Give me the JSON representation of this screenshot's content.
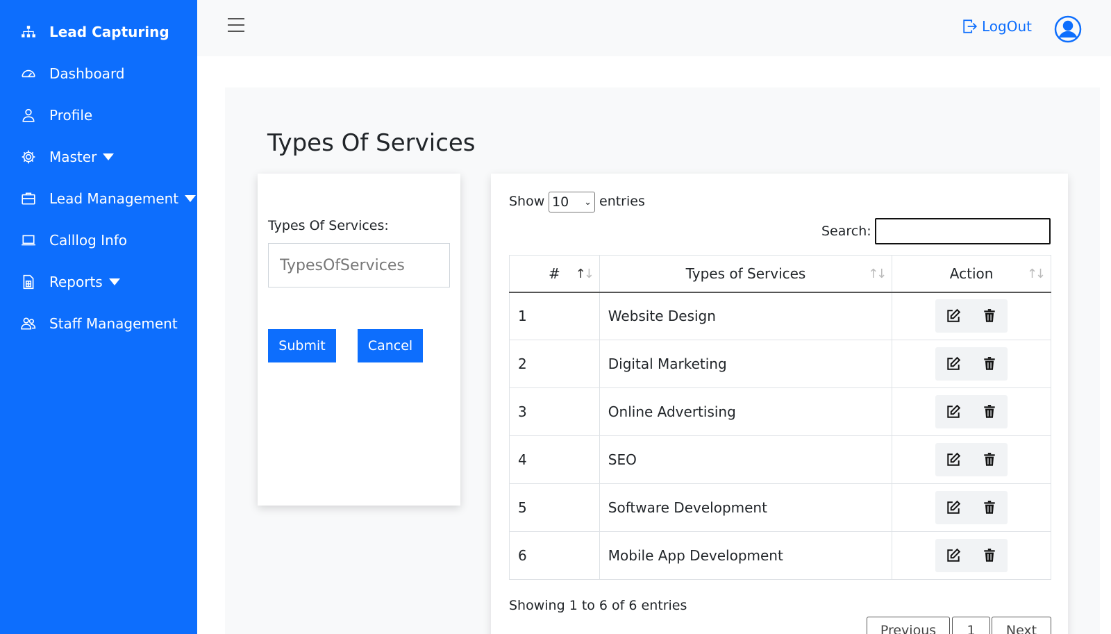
{
  "sidebar": {
    "brand": "Lead Capturing",
    "items": [
      {
        "label": "Dashboard",
        "icon": "speedometer-icon"
      },
      {
        "label": "Profile",
        "icon": "person-icon"
      },
      {
        "label": "Master",
        "icon": "gear-icon",
        "dropdown": true
      },
      {
        "label": "Lead Management",
        "icon": "briefcase-icon",
        "dropdown": true
      },
      {
        "label": "Calllog Info",
        "icon": "laptop-icon"
      },
      {
        "label": "Reports",
        "icon": "report-icon",
        "dropdown": true
      },
      {
        "label": "Staff Management",
        "icon": "people-icon"
      }
    ]
  },
  "header": {
    "logout_label": "LogOut"
  },
  "page": {
    "title": "Types Of Services"
  },
  "form": {
    "label": "Types Of Services:",
    "placeholder": "TypesOfServices",
    "submit_label": "Submit",
    "cancel_label": "Cancel"
  },
  "table": {
    "show_label": "Show",
    "page_size": "10",
    "entries_label": "entries",
    "search_label": "Search:",
    "columns": [
      "#",
      "Types of Services",
      "Action"
    ],
    "rows": [
      {
        "num": "1",
        "service": "Website Design"
      },
      {
        "num": "2",
        "service": "Digital Marketing"
      },
      {
        "num": "3",
        "service": "Online Advertising"
      },
      {
        "num": "4",
        "service": "SEO"
      },
      {
        "num": "5",
        "service": "Software Development"
      },
      {
        "num": "6",
        "service": "Mobile App Development"
      }
    ],
    "info": "Showing 1 to 6 of 6 entries",
    "pagination": {
      "previous": "Previous",
      "page": "1",
      "next": "Next"
    }
  },
  "colors": {
    "accent": "#0d6efd",
    "header_bg": "#f8f9fa"
  }
}
